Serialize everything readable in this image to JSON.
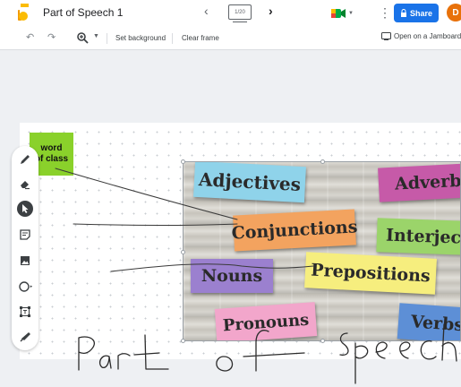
{
  "header": {
    "title": "Part of Speech 1",
    "frame_counter": "1/20",
    "share_label": "Share",
    "avatar_initial": "D"
  },
  "toolbar": {
    "set_background": "Set background",
    "clear_frame": "Clear frame",
    "open_on_jamboard": "Open on a Jamboard"
  },
  "tools": [
    "pen-icon",
    "eraser-icon",
    "select-icon",
    "sticky-note-icon",
    "image-icon",
    "circle-icon",
    "text-box-icon",
    "laser-icon"
  ],
  "sticky_note": {
    "text": "word\nof class",
    "line1": "word",
    "line2": "of class",
    "color": "#8ad12b"
  },
  "image_cards": [
    {
      "label": "Adjectives",
      "color": "#8fd3ea"
    },
    {
      "label": "Adverbs",
      "color": "#c65aa8"
    },
    {
      "label": "Conjunctions",
      "color": "#f3a35f"
    },
    {
      "label": "Interject",
      "color": "#9bd46a"
    },
    {
      "label": "Nouns",
      "color": "#9b80cf"
    },
    {
      "label": "Prepositions",
      "color": "#f6ee7e"
    },
    {
      "label": "Pronouns",
      "color": "#f2a6cb"
    },
    {
      "label": "Verbs",
      "color": "#5d8fd6"
    }
  ],
  "handwriting": "Part of speech",
  "colors": {
    "accent": "#1a73e8",
    "sticky": "#8ad12b"
  }
}
